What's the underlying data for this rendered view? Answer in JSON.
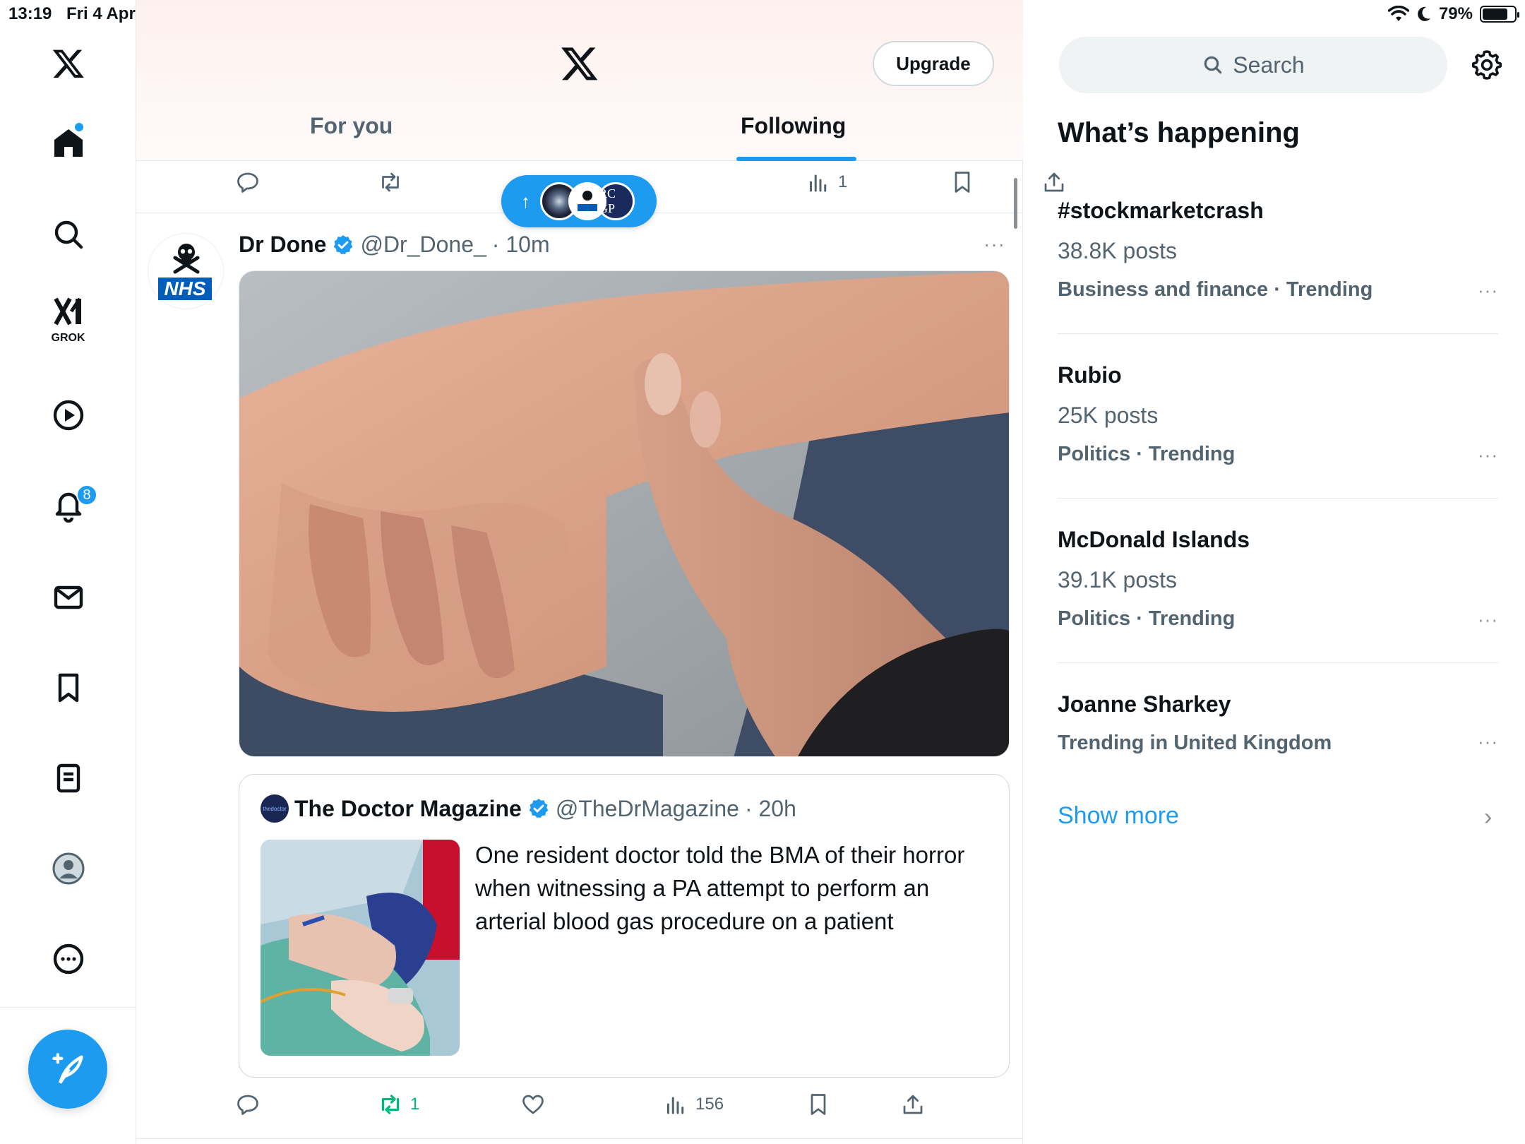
{
  "status_bar": {
    "time": "13:19",
    "date": "Fri 4 Apr",
    "battery": "79%",
    "battery_level": 0.79
  },
  "nav": {
    "grok_label": "GROK",
    "notifications_count": "8",
    "items": [
      "home-icon",
      "search-icon",
      "grok-icon",
      "video-icon",
      "bell-icon",
      "mail-icon",
      "bookmark-icon",
      "list-icon",
      "profile-icon",
      "more-icon"
    ]
  },
  "header": {
    "upgrade_label": "Upgrade",
    "tabs": [
      {
        "label": "For you"
      },
      {
        "label": "Following"
      }
    ],
    "active_tab": "Following"
  },
  "prev_tweet_actions": {
    "views": "1"
  },
  "new_posts_pill": {
    "arrow": "↑",
    "third_avatar_text": "RC GP"
  },
  "tweet": {
    "author_name": "Dr Done",
    "author_handle": "@Dr_Done_",
    "time": "· 10m",
    "avatar_text": "NHS",
    "more": "···",
    "quote": {
      "author_name": "The Doctor Magazine",
      "author_handle": "@TheDrMagazine",
      "time": "· 20h",
      "avatar_text": "thedoctor",
      "text": "One resident doctor told the BMA of their horror when witnessing a PA attempt to perform an arterial blood gas procedure on a patient"
    },
    "actions": {
      "retweets": "1",
      "views": "156"
    }
  },
  "sidebar": {
    "search_placeholder": "Search",
    "section_title": "What’s happening",
    "trends": [
      {
        "name": "#stockmarketcrash",
        "posts": "38.8K posts",
        "category": "Business and finance · Trending"
      },
      {
        "name": "Rubio",
        "posts": "25K posts",
        "category": "Politics · Trending"
      },
      {
        "name": "McDonald Islands",
        "posts": "39.1K posts",
        "category": "Politics · Trending"
      },
      {
        "name": "Joanne Sharkey",
        "posts": "",
        "category": "Trending in United Kingdom"
      }
    ],
    "trend_more": "···",
    "show_more": "Show more",
    "show_more_chevron": "›"
  },
  "colors": {
    "accent": "#1d9bf0",
    "retweet_active": "#00ba7c",
    "secondary_text": "#536471"
  }
}
